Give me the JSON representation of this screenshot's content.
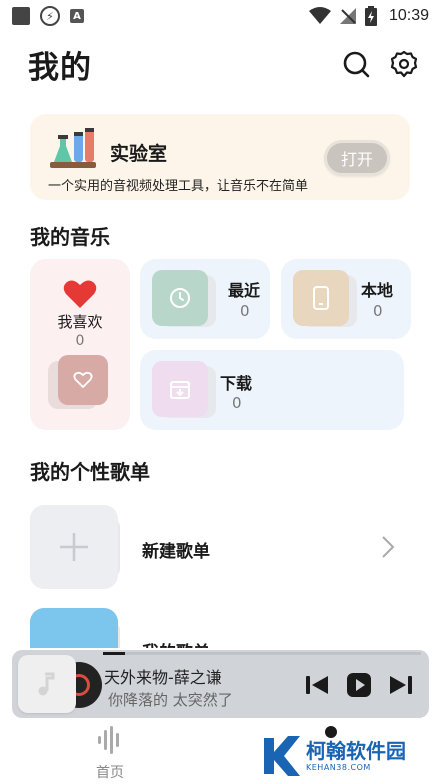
{
  "status_bar": {
    "time": "10:39",
    "notif_letter": "A"
  },
  "header": {
    "title": "我的"
  },
  "lab": {
    "title": "实验室",
    "description": "一个实用的音视频处理工具，让音乐不在简单",
    "open_label": "打开"
  },
  "my_music": {
    "section_title": "我的音乐",
    "favorites": {
      "label": "我喜欢",
      "count": "0"
    },
    "recent": {
      "label": "最近",
      "count": "0"
    },
    "local": {
      "label": "本地",
      "count": "0"
    },
    "downloads": {
      "label": "下载",
      "count": "0"
    }
  },
  "playlists": {
    "section_title": "我的个性歌单",
    "new_label": "新建歌单",
    "my_playlist_label": "我的歌单"
  },
  "player": {
    "title": "天外来物-薛之谦",
    "lyric": "你降落的 太突然了",
    "progress": 0.07
  },
  "tabbar": {
    "home_label": "首页"
  },
  "watermark": {
    "text": "柯翰软件园",
    "sub": "KEHAN38.COM"
  },
  "colors": {
    "lab_bg": "#fdf5e9",
    "fav_bg": "#fdf0f0",
    "tile_bg": "#eef4fb",
    "heart": "#e53935",
    "player_bg": "#d0d3d8"
  }
}
